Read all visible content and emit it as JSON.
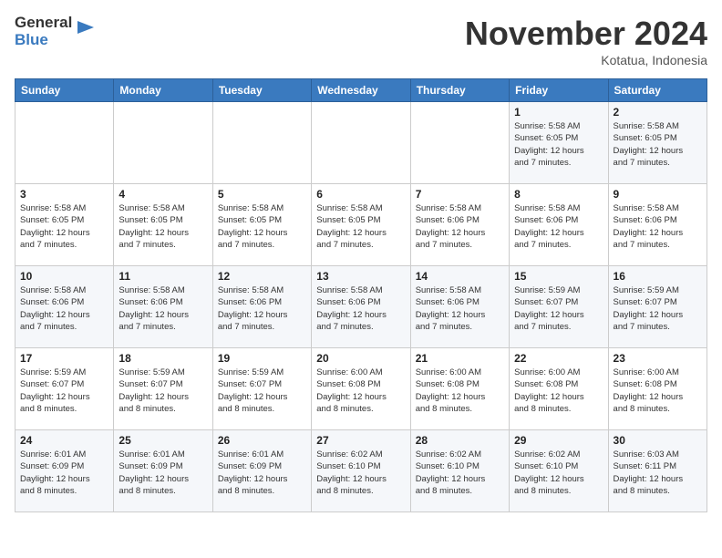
{
  "header": {
    "logo_line1": "General",
    "logo_line2": "Blue",
    "month": "November 2024",
    "location": "Kotatua, Indonesia"
  },
  "weekdays": [
    "Sunday",
    "Monday",
    "Tuesday",
    "Wednesday",
    "Thursday",
    "Friday",
    "Saturday"
  ],
  "weeks": [
    [
      {
        "day": "",
        "info": ""
      },
      {
        "day": "",
        "info": ""
      },
      {
        "day": "",
        "info": ""
      },
      {
        "day": "",
        "info": ""
      },
      {
        "day": "",
        "info": ""
      },
      {
        "day": "1",
        "info": "Sunrise: 5:58 AM\nSunset: 6:05 PM\nDaylight: 12 hours\nand 7 minutes."
      },
      {
        "day": "2",
        "info": "Sunrise: 5:58 AM\nSunset: 6:05 PM\nDaylight: 12 hours\nand 7 minutes."
      }
    ],
    [
      {
        "day": "3",
        "info": "Sunrise: 5:58 AM\nSunset: 6:05 PM\nDaylight: 12 hours\nand 7 minutes."
      },
      {
        "day": "4",
        "info": "Sunrise: 5:58 AM\nSunset: 6:05 PM\nDaylight: 12 hours\nand 7 minutes."
      },
      {
        "day": "5",
        "info": "Sunrise: 5:58 AM\nSunset: 6:05 PM\nDaylight: 12 hours\nand 7 minutes."
      },
      {
        "day": "6",
        "info": "Sunrise: 5:58 AM\nSunset: 6:05 PM\nDaylight: 12 hours\nand 7 minutes."
      },
      {
        "day": "7",
        "info": "Sunrise: 5:58 AM\nSunset: 6:06 PM\nDaylight: 12 hours\nand 7 minutes."
      },
      {
        "day": "8",
        "info": "Sunrise: 5:58 AM\nSunset: 6:06 PM\nDaylight: 12 hours\nand 7 minutes."
      },
      {
        "day": "9",
        "info": "Sunrise: 5:58 AM\nSunset: 6:06 PM\nDaylight: 12 hours\nand 7 minutes."
      }
    ],
    [
      {
        "day": "10",
        "info": "Sunrise: 5:58 AM\nSunset: 6:06 PM\nDaylight: 12 hours\nand 7 minutes."
      },
      {
        "day": "11",
        "info": "Sunrise: 5:58 AM\nSunset: 6:06 PM\nDaylight: 12 hours\nand 7 minutes."
      },
      {
        "day": "12",
        "info": "Sunrise: 5:58 AM\nSunset: 6:06 PM\nDaylight: 12 hours\nand 7 minutes."
      },
      {
        "day": "13",
        "info": "Sunrise: 5:58 AM\nSunset: 6:06 PM\nDaylight: 12 hours\nand 7 minutes."
      },
      {
        "day": "14",
        "info": "Sunrise: 5:58 AM\nSunset: 6:06 PM\nDaylight: 12 hours\nand 7 minutes."
      },
      {
        "day": "15",
        "info": "Sunrise: 5:59 AM\nSunset: 6:07 PM\nDaylight: 12 hours\nand 7 minutes."
      },
      {
        "day": "16",
        "info": "Sunrise: 5:59 AM\nSunset: 6:07 PM\nDaylight: 12 hours\nand 7 minutes."
      }
    ],
    [
      {
        "day": "17",
        "info": "Sunrise: 5:59 AM\nSunset: 6:07 PM\nDaylight: 12 hours\nand 8 minutes."
      },
      {
        "day": "18",
        "info": "Sunrise: 5:59 AM\nSunset: 6:07 PM\nDaylight: 12 hours\nand 8 minutes."
      },
      {
        "day": "19",
        "info": "Sunrise: 5:59 AM\nSunset: 6:07 PM\nDaylight: 12 hours\nand 8 minutes."
      },
      {
        "day": "20",
        "info": "Sunrise: 6:00 AM\nSunset: 6:08 PM\nDaylight: 12 hours\nand 8 minutes."
      },
      {
        "day": "21",
        "info": "Sunrise: 6:00 AM\nSunset: 6:08 PM\nDaylight: 12 hours\nand 8 minutes."
      },
      {
        "day": "22",
        "info": "Sunrise: 6:00 AM\nSunset: 6:08 PM\nDaylight: 12 hours\nand 8 minutes."
      },
      {
        "day": "23",
        "info": "Sunrise: 6:00 AM\nSunset: 6:08 PM\nDaylight: 12 hours\nand 8 minutes."
      }
    ],
    [
      {
        "day": "24",
        "info": "Sunrise: 6:01 AM\nSunset: 6:09 PM\nDaylight: 12 hours\nand 8 minutes."
      },
      {
        "day": "25",
        "info": "Sunrise: 6:01 AM\nSunset: 6:09 PM\nDaylight: 12 hours\nand 8 minutes."
      },
      {
        "day": "26",
        "info": "Sunrise: 6:01 AM\nSunset: 6:09 PM\nDaylight: 12 hours\nand 8 minutes."
      },
      {
        "day": "27",
        "info": "Sunrise: 6:02 AM\nSunset: 6:10 PM\nDaylight: 12 hours\nand 8 minutes."
      },
      {
        "day": "28",
        "info": "Sunrise: 6:02 AM\nSunset: 6:10 PM\nDaylight: 12 hours\nand 8 minutes."
      },
      {
        "day": "29",
        "info": "Sunrise: 6:02 AM\nSunset: 6:10 PM\nDaylight: 12 hours\nand 8 minutes."
      },
      {
        "day": "30",
        "info": "Sunrise: 6:03 AM\nSunset: 6:11 PM\nDaylight: 12 hours\nand 8 minutes."
      }
    ]
  ]
}
